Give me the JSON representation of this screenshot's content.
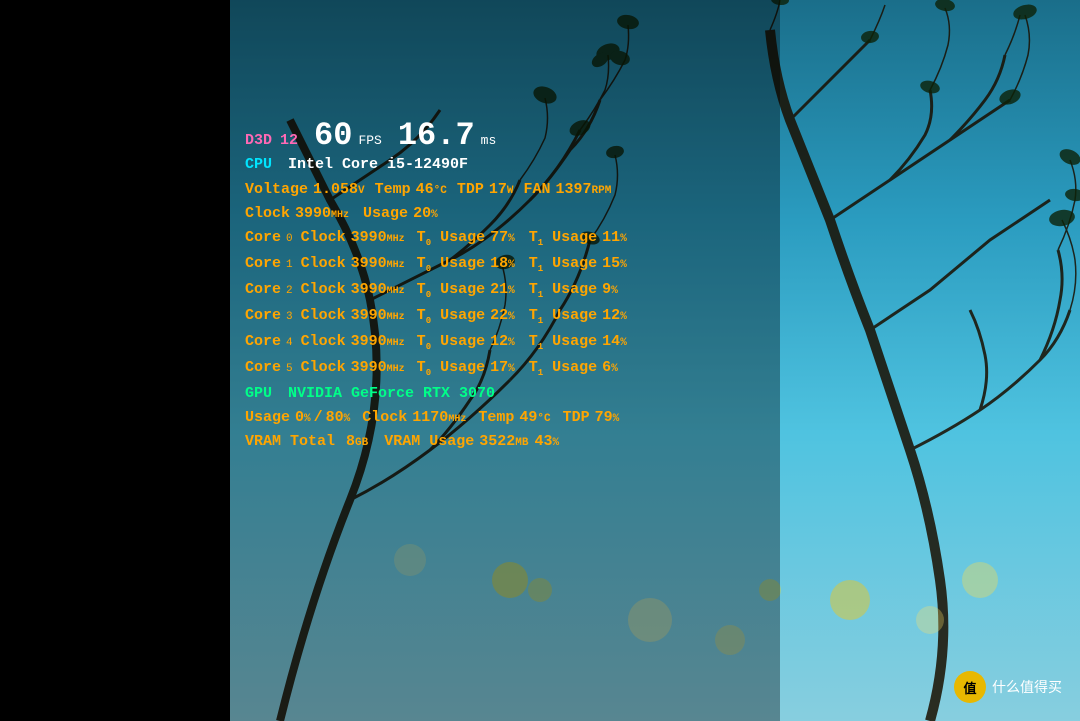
{
  "hud": {
    "line1": {
      "d3d_label": "D3D",
      "d3d_version": "12",
      "fps_value": "60",
      "fps_unit": "FPS",
      "ms_value": "16.7",
      "ms_unit": "ms"
    },
    "line2": {
      "cpu_label": "CPU",
      "cpu_name": "Intel Core i5-12490F"
    },
    "line3": {
      "voltage_label": "Voltage",
      "voltage_value": "1.058",
      "voltage_unit": "V",
      "temp_label": "Temp",
      "temp_value": "46",
      "temp_unit": "°C",
      "tdp_label": "TDP",
      "tdp_value": "17",
      "tdp_unit": "W",
      "fan_label": "FAN",
      "fan_value": "1397",
      "fan_unit": "RPM"
    },
    "line4": {
      "clock_label": "Clock",
      "clock_value": "3990",
      "clock_unit": "MHz",
      "usage_label": "Usage",
      "usage_value": "20",
      "usage_unit": "%"
    },
    "cores": [
      {
        "core_label": "Core",
        "core_sub": "0",
        "clock_value": "3990",
        "t0_usage": "77",
        "t1_usage": "11"
      },
      {
        "core_label": "Core",
        "core_sub": "1",
        "clock_value": "3990",
        "t0_usage": "18",
        "t1_usage": "15"
      },
      {
        "core_label": "Core",
        "core_sub": "2",
        "clock_value": "3990",
        "t0_usage": "21",
        "t1_usage": "9"
      },
      {
        "core_label": "Core",
        "core_sub": "3",
        "clock_value": "3990",
        "t0_usage": "22",
        "t1_usage": "12"
      },
      {
        "core_label": "Core",
        "core_sub": "4",
        "clock_value": "3990",
        "t0_usage": "12",
        "t1_usage": "14"
      },
      {
        "core_label": "Core",
        "core_sub": "5",
        "clock_value": "3990",
        "t0_usage": "17",
        "t1_usage": "6"
      }
    ],
    "gpu_line": {
      "gpu_label": "GPU",
      "gpu_name": "NVIDIA GeForce RTX 3070"
    },
    "gpu_stats": {
      "usage_label": "Usage",
      "usage_value": "0",
      "usage_slash": "/",
      "usage_value2": "80",
      "clock_label": "Clock",
      "clock_value": "1170",
      "clock_unit": "MHz",
      "temp_label": "Temp",
      "temp_value": "49",
      "temp_unit": "°C",
      "tdp_label": "TDP",
      "tdp_value": "79",
      "tdp_unit": "%"
    },
    "vram_line": {
      "vram_total_label": "VRAM Total",
      "vram_total_value": "8",
      "vram_total_unit": "GB",
      "vram_usage_label": "VRAM Usage",
      "vram_usage_value": "3522",
      "vram_usage_unit": "MB",
      "vram_usage_pct": "43",
      "vram_usage_pct_unit": "%"
    }
  },
  "watermark": {
    "icon": "值",
    "text": "什么值得买"
  }
}
